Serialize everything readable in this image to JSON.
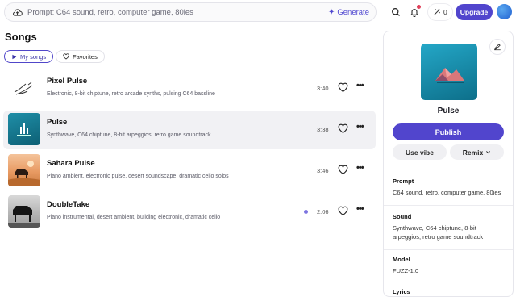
{
  "topbar": {
    "prompt_placeholder": "Prompt: C64 sound, retro, computer game, 80ies",
    "generate_label": "Generate",
    "credits": "0",
    "upgrade_label": "Upgrade"
  },
  "main": {
    "title": "Songs",
    "tabs": [
      {
        "label": "My songs",
        "active": true
      },
      {
        "label": "Favorites",
        "active": false
      }
    ],
    "songs": [
      {
        "title": "Pixel Pulse",
        "description": "Electronic, 8-bit chiptune, retro arcade synths, pulsing C64 bassline",
        "duration": "3:40",
        "selected": false,
        "thumb": "line-art"
      },
      {
        "title": "Pulse",
        "description": "Synthwave, C64 chiptune, 8-bit arpeggios, retro game soundtrack",
        "duration": "3:38",
        "selected": true,
        "thumb": "teal-bars"
      },
      {
        "title": "Sahara Pulse",
        "description": "Piano ambient, electronic pulse, desert soundscape, dramatic cello solos",
        "duration": "3:46",
        "selected": false,
        "thumb": "desert-piano"
      },
      {
        "title": "DoubleTake",
        "description": "Piano instrumental, desert ambient, building electronic, dramatic cello",
        "duration": "2:06",
        "selected": false,
        "thumb": "bw-piano"
      }
    ]
  },
  "detail": {
    "title": "Pulse",
    "publish_label": "Publish",
    "use_vibe_label": "Use vibe",
    "remix_label": "Remix",
    "prompt_label": "Prompt",
    "prompt_value": "C64 sound, retro, computer game, 80ies",
    "sound_label": "Sound",
    "sound_value": "Synthwave, C64 chiptune, 8-bit arpeggios, retro game soundtrack",
    "model_label": "Model",
    "model_value": "FUZZ-1.0",
    "lyrics_label": "Lyrics"
  },
  "colors": {
    "accent": "#5145cd",
    "selected_row": "#f1f1f4",
    "unread_dot": "#7c74e0",
    "notification": "#e0405a"
  }
}
